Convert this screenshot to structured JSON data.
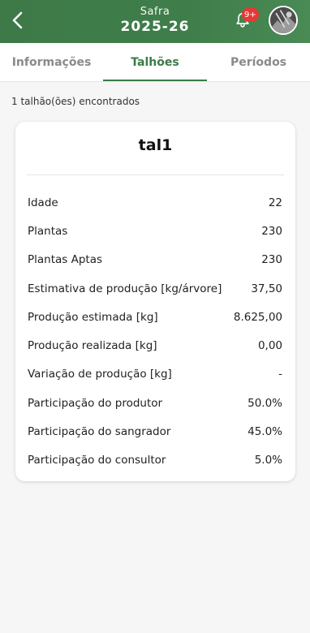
{
  "header": {
    "title_top": "Safra",
    "title_main": "2025-26",
    "notification_badge": "9+"
  },
  "tabs": [
    {
      "label": "Informações",
      "active": false
    },
    {
      "label": "Talhões",
      "active": true
    },
    {
      "label": "Períodos",
      "active": false
    }
  ],
  "results_text": "1 talhão(ões) encontrados",
  "card": {
    "title": "tal1",
    "rows": [
      {
        "label": "Idade",
        "value": "22"
      },
      {
        "label": "Plantas",
        "value": "230"
      },
      {
        "label": "Plantas Aptas",
        "value": "230"
      },
      {
        "label": "Estimativa de produção [kg/árvore]",
        "value": "37,50"
      },
      {
        "label": "Produção estimada [kg]",
        "value": "8.625,00"
      },
      {
        "label": "Produção realizada [kg]",
        "value": "0,00"
      },
      {
        "label": "Variação de produção [kg]",
        "value": "-"
      },
      {
        "label": "Participação do produtor",
        "value": "50.0%"
      },
      {
        "label": "Participação do sangrador",
        "value": "45.0%"
      },
      {
        "label": "Participação do consultor",
        "value": "5.0%"
      }
    ]
  },
  "colors": {
    "appbar": "#3f7e4a",
    "accent": "#3b7a47",
    "badge": "#e53935"
  },
  "icons": [
    "chevron-left-icon",
    "bell-icon"
  ]
}
